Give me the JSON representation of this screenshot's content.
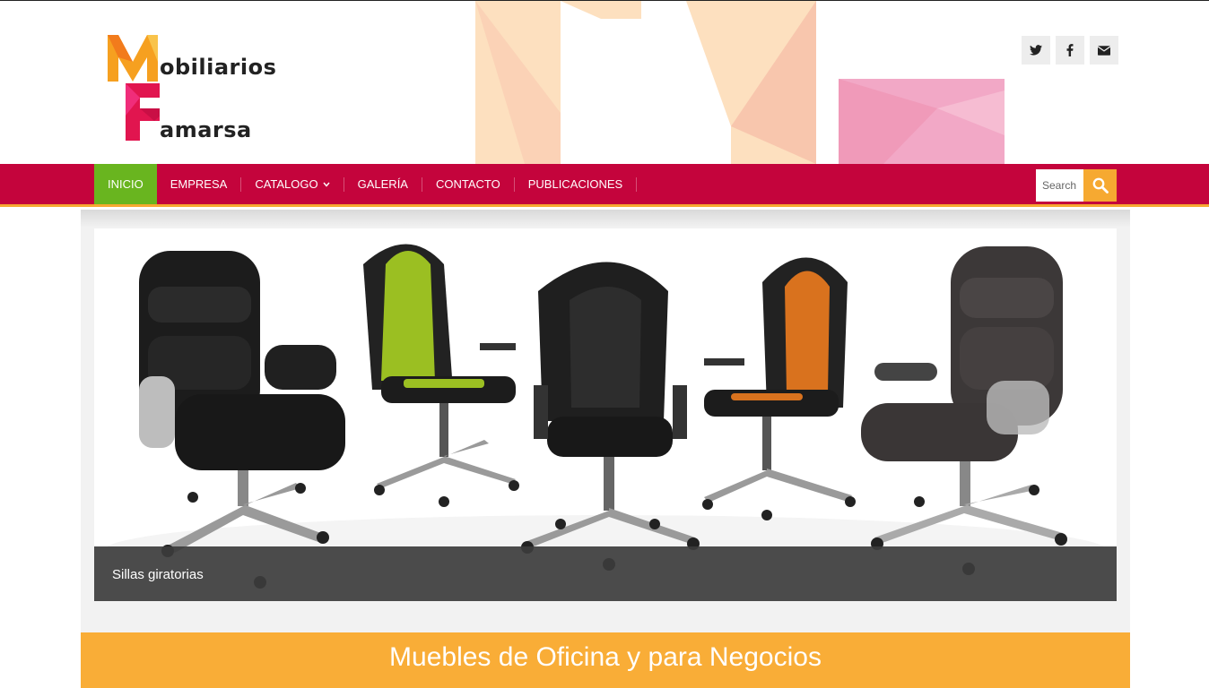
{
  "site": {
    "logo_line1": "obiliarios",
    "logo_line2": "amarsa",
    "logo_initial1": "M",
    "logo_initial2": "F"
  },
  "social": [
    {
      "icon": "twitter-icon",
      "glyph": "t"
    },
    {
      "icon": "facebook-icon",
      "glyph": "f"
    },
    {
      "icon": "email-icon",
      "glyph": "✉"
    }
  ],
  "nav": {
    "items": [
      {
        "label": "INICIO",
        "active": true
      },
      {
        "label": "EMPRESA",
        "active": false
      },
      {
        "label": "CATALOGO",
        "active": false,
        "dropdown": true
      },
      {
        "label": "GALERÍA",
        "active": false
      },
      {
        "label": "CONTACTO",
        "active": false
      },
      {
        "label": "PUBLICACIONES",
        "active": false
      }
    ],
    "search_placeholder": "Search"
  },
  "slider": {
    "caption": "Sillas giratorias"
  },
  "banner": {
    "title": "Muebles de Oficina y para Negocios"
  },
  "colors": {
    "nav_bg": "#c4043c",
    "nav_border": "#f6a931",
    "active": "#69b51f",
    "accent": "#f9ad37"
  }
}
